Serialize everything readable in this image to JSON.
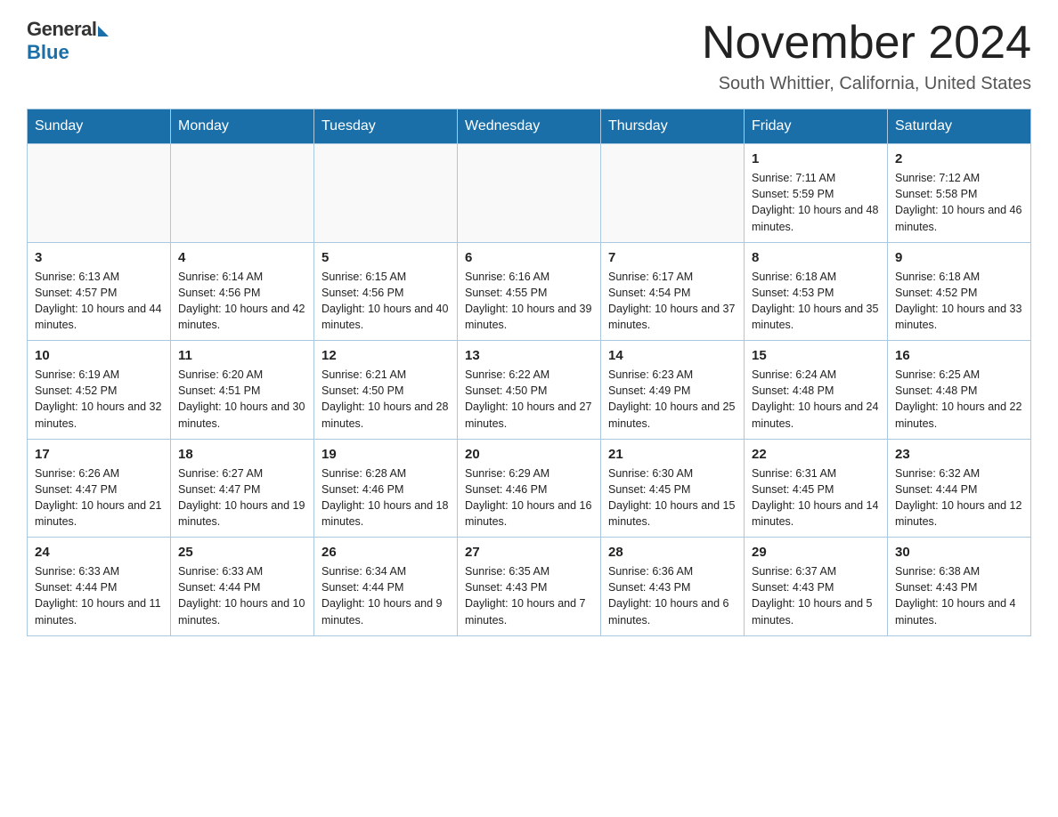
{
  "logo": {
    "general_text": "General",
    "blue_text": "Blue"
  },
  "header": {
    "month_title": "November 2024",
    "location": "South Whittier, California, United States"
  },
  "weekdays": [
    "Sunday",
    "Monday",
    "Tuesday",
    "Wednesday",
    "Thursday",
    "Friday",
    "Saturday"
  ],
  "weeks": [
    [
      {
        "day": "",
        "info": ""
      },
      {
        "day": "",
        "info": ""
      },
      {
        "day": "",
        "info": ""
      },
      {
        "day": "",
        "info": ""
      },
      {
        "day": "",
        "info": ""
      },
      {
        "day": "1",
        "info": "Sunrise: 7:11 AM\nSunset: 5:59 PM\nDaylight: 10 hours and 48 minutes."
      },
      {
        "day": "2",
        "info": "Sunrise: 7:12 AM\nSunset: 5:58 PM\nDaylight: 10 hours and 46 minutes."
      }
    ],
    [
      {
        "day": "3",
        "info": "Sunrise: 6:13 AM\nSunset: 4:57 PM\nDaylight: 10 hours and 44 minutes."
      },
      {
        "day": "4",
        "info": "Sunrise: 6:14 AM\nSunset: 4:56 PM\nDaylight: 10 hours and 42 minutes."
      },
      {
        "day": "5",
        "info": "Sunrise: 6:15 AM\nSunset: 4:56 PM\nDaylight: 10 hours and 40 minutes."
      },
      {
        "day": "6",
        "info": "Sunrise: 6:16 AM\nSunset: 4:55 PM\nDaylight: 10 hours and 39 minutes."
      },
      {
        "day": "7",
        "info": "Sunrise: 6:17 AM\nSunset: 4:54 PM\nDaylight: 10 hours and 37 minutes."
      },
      {
        "day": "8",
        "info": "Sunrise: 6:18 AM\nSunset: 4:53 PM\nDaylight: 10 hours and 35 minutes."
      },
      {
        "day": "9",
        "info": "Sunrise: 6:18 AM\nSunset: 4:52 PM\nDaylight: 10 hours and 33 minutes."
      }
    ],
    [
      {
        "day": "10",
        "info": "Sunrise: 6:19 AM\nSunset: 4:52 PM\nDaylight: 10 hours and 32 minutes."
      },
      {
        "day": "11",
        "info": "Sunrise: 6:20 AM\nSunset: 4:51 PM\nDaylight: 10 hours and 30 minutes."
      },
      {
        "day": "12",
        "info": "Sunrise: 6:21 AM\nSunset: 4:50 PM\nDaylight: 10 hours and 28 minutes."
      },
      {
        "day": "13",
        "info": "Sunrise: 6:22 AM\nSunset: 4:50 PM\nDaylight: 10 hours and 27 minutes."
      },
      {
        "day": "14",
        "info": "Sunrise: 6:23 AM\nSunset: 4:49 PM\nDaylight: 10 hours and 25 minutes."
      },
      {
        "day": "15",
        "info": "Sunrise: 6:24 AM\nSunset: 4:48 PM\nDaylight: 10 hours and 24 minutes."
      },
      {
        "day": "16",
        "info": "Sunrise: 6:25 AM\nSunset: 4:48 PM\nDaylight: 10 hours and 22 minutes."
      }
    ],
    [
      {
        "day": "17",
        "info": "Sunrise: 6:26 AM\nSunset: 4:47 PM\nDaylight: 10 hours and 21 minutes."
      },
      {
        "day": "18",
        "info": "Sunrise: 6:27 AM\nSunset: 4:47 PM\nDaylight: 10 hours and 19 minutes."
      },
      {
        "day": "19",
        "info": "Sunrise: 6:28 AM\nSunset: 4:46 PM\nDaylight: 10 hours and 18 minutes."
      },
      {
        "day": "20",
        "info": "Sunrise: 6:29 AM\nSunset: 4:46 PM\nDaylight: 10 hours and 16 minutes."
      },
      {
        "day": "21",
        "info": "Sunrise: 6:30 AM\nSunset: 4:45 PM\nDaylight: 10 hours and 15 minutes."
      },
      {
        "day": "22",
        "info": "Sunrise: 6:31 AM\nSunset: 4:45 PM\nDaylight: 10 hours and 14 minutes."
      },
      {
        "day": "23",
        "info": "Sunrise: 6:32 AM\nSunset: 4:44 PM\nDaylight: 10 hours and 12 minutes."
      }
    ],
    [
      {
        "day": "24",
        "info": "Sunrise: 6:33 AM\nSunset: 4:44 PM\nDaylight: 10 hours and 11 minutes."
      },
      {
        "day": "25",
        "info": "Sunrise: 6:33 AM\nSunset: 4:44 PM\nDaylight: 10 hours and 10 minutes."
      },
      {
        "day": "26",
        "info": "Sunrise: 6:34 AM\nSunset: 4:44 PM\nDaylight: 10 hours and 9 minutes."
      },
      {
        "day": "27",
        "info": "Sunrise: 6:35 AM\nSunset: 4:43 PM\nDaylight: 10 hours and 7 minutes."
      },
      {
        "day": "28",
        "info": "Sunrise: 6:36 AM\nSunset: 4:43 PM\nDaylight: 10 hours and 6 minutes."
      },
      {
        "day": "29",
        "info": "Sunrise: 6:37 AM\nSunset: 4:43 PM\nDaylight: 10 hours and 5 minutes."
      },
      {
        "day": "30",
        "info": "Sunrise: 6:38 AM\nSunset: 4:43 PM\nDaylight: 10 hours and 4 minutes."
      }
    ]
  ]
}
